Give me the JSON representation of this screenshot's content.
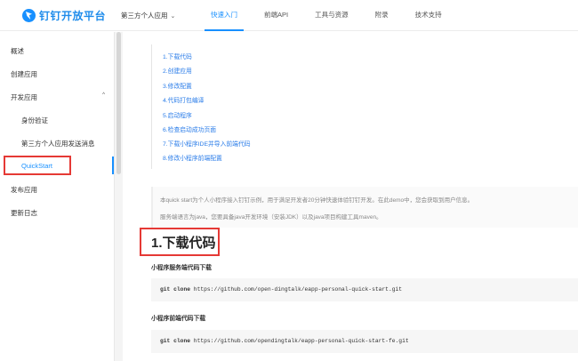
{
  "header": {
    "logo_text": "钉钉开放平台",
    "app_select": "第三方个人应用",
    "nav": [
      "快速入门",
      "前端API",
      "工具与资源",
      "附录",
      "技术支持"
    ]
  },
  "sidebar": {
    "items": [
      {
        "label": "概述"
      },
      {
        "label": "创建应用"
      },
      {
        "label": "开发应用",
        "toggle": "^"
      },
      {
        "label": "身份验证"
      },
      {
        "label": "第三方个人应用发送消息"
      },
      {
        "label": "QuickStart"
      },
      {
        "label": "发布应用"
      },
      {
        "label": "更新日志"
      }
    ]
  },
  "toc": [
    "1.下载代码",
    "2.创建应用",
    "3.修改配置",
    "4.代码打包编译",
    "5.启动程序",
    "6.检查启动成功页面",
    "7.下载小程序IDE并导入前端代码",
    "8.修改小程序前端配置"
  ],
  "intro": {
    "line1": "本quick start为个人小程序接入钉钉示例，用于满足开发者20分钟快速体验钉钉开发。在此demo中，您会获取到用户信息。",
    "line2": "服务端语言为java，您要具备java开发环境（安装JDK）以及java项目构建工具maven。"
  },
  "section": {
    "title": "1.下载代码",
    "server_heading": "小程序服务端代码下载",
    "server_cmd": "git clone",
    "server_url": "https://github.com/open-dingtalk/eapp-personal-quick-start.git",
    "frontend_heading": "小程序前端代码下载",
    "frontend_cmd": "git clone",
    "frontend_url": "https://github.com/opendingtalk/eapp-personal-quick-start-fe.git"
  },
  "colors": {
    "accent": "#1890ff",
    "highlight": "#e53935"
  }
}
